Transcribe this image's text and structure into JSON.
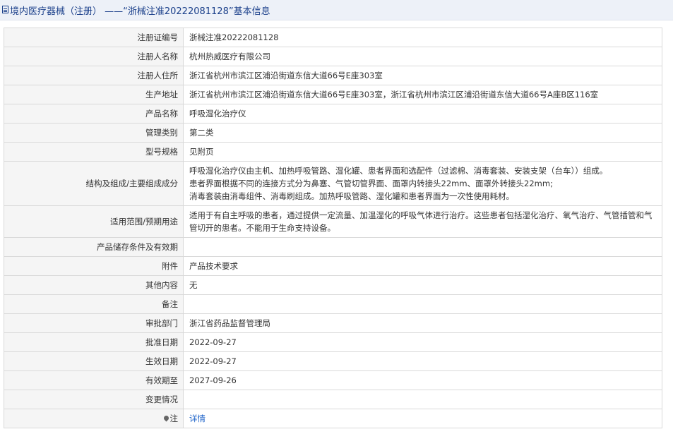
{
  "header": {
    "title": "境内医疗器械（注册） ——“浙械注准20222081128”基本信息",
    "icon": "document-icon",
    "accent_color": "#1a3f8a"
  },
  "rows": [
    {
      "label": "注册证编号",
      "lines": [
        "浙械注准20222081128"
      ]
    },
    {
      "label": "注册人名称",
      "lines": [
        "杭州热威医疗有限公司"
      ]
    },
    {
      "label": "注册人住所",
      "lines": [
        "浙江省杭州市滨江区浦沿街道东信大道66号E座303室"
      ]
    },
    {
      "label": "生产地址",
      "lines": [
        "浙江省杭州市滨江区浦沿街道东信大道66号E座303室，浙江省杭州市滨江区浦沿街道东信大道66号A座B区116室"
      ]
    },
    {
      "label": "产品名称",
      "lines": [
        "呼吸湿化治疗仪"
      ]
    },
    {
      "label": "管理类别",
      "lines": [
        "第二类"
      ]
    },
    {
      "label": "型号规格",
      "lines": [
        "见附页"
      ]
    },
    {
      "label": "结构及组成/主要组成成分",
      "lines": [
        "呼吸湿化治疗仪由主机、加热呼吸管路、湿化罐、患者界面和选配件（过滤棉、消毒套装、安装支架（台车））组成。",
        "患者界面根据不同的连接方式分为鼻塞、气管切管界面、面罩内转接头22mm、面罩外转接头22mm;",
        "消毒套装由消毒组件、消毒刷组成。加热呼吸管路、湿化罐和患者界面为一次性使用耗材。"
      ]
    },
    {
      "label": "适用范围/预期用途",
      "lines": [
        "适用于有自主呼吸的患者，通过提供一定流量、加温湿化的呼吸气体进行治疗。这些患者包括湿化治疗、氧气治疗、气管插管和气管切开的患者。不能用于生命支持设备。"
      ]
    },
    {
      "label": "产品储存条件及有效期",
      "lines": [
        ""
      ]
    },
    {
      "label": "附件",
      "lines": [
        "产品技术要求"
      ]
    },
    {
      "label": "其他内容",
      "lines": [
        "无"
      ]
    },
    {
      "label": "备注",
      "lines": [
        ""
      ]
    },
    {
      "label": "审批部门",
      "lines": [
        "浙江省药品监督管理局"
      ]
    },
    {
      "label": "批准日期",
      "lines": [
        "2022-09-27"
      ]
    },
    {
      "label": "生效日期",
      "lines": [
        "2022-09-27"
      ]
    },
    {
      "label": "有效期至",
      "lines": [
        "2027-09-26"
      ]
    },
    {
      "label": "变更情况",
      "lines": [
        ""
      ]
    }
  ],
  "note_row": {
    "label": "注",
    "icon": "location-pin-icon",
    "link_text": "详情",
    "link_color": "#1a60c8"
  }
}
